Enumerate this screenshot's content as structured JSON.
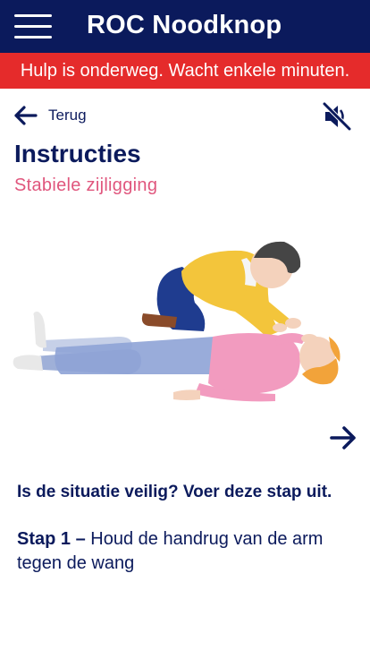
{
  "header": {
    "title": "ROC Noodknop",
    "menu_icon": "hamburger-icon"
  },
  "alert": {
    "text": "Hulp is onderweg. Wacht enkele minuten."
  },
  "nav": {
    "back_label": "Terug",
    "back_icon": "arrow-left-icon",
    "mute_icon": "speaker-muted-icon",
    "next_icon": "arrow-right-icon"
  },
  "content": {
    "title": "Instructies",
    "subtitle": "Stabiele zijligging",
    "question": "Is de situatie veilig? Voer deze stap uit.",
    "step_label": "Stap 1",
    "step_dash": " – ",
    "step_text": "Houd de handrug van de arm tegen de wang"
  },
  "colors": {
    "header_bg": "#0b1a5c",
    "alert_bg": "#e52b2b",
    "subtitle": "#e0567d",
    "text": "#0b1a5c"
  }
}
